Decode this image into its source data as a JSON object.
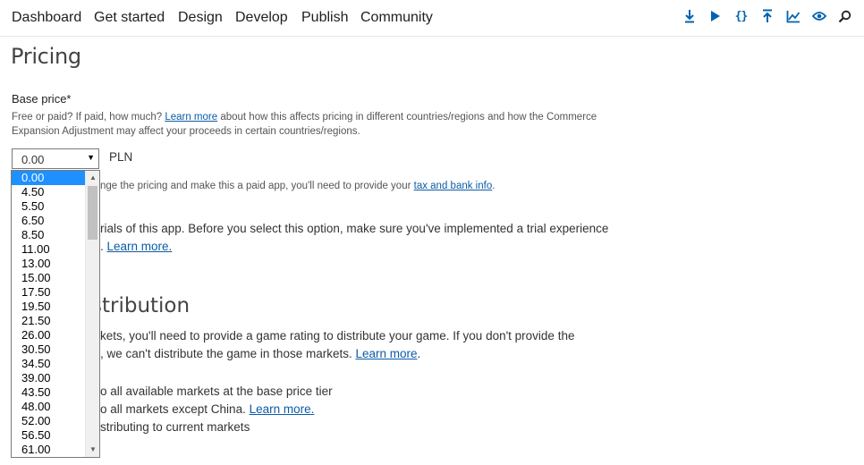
{
  "nav": {
    "items": [
      "Dashboard",
      "Get started",
      "Design",
      "Develop",
      "Publish",
      "Community"
    ]
  },
  "toolbar": {
    "icons": [
      "download-icon",
      "play-icon",
      "code-icon",
      "upload-icon",
      "chart-icon",
      "eye-icon",
      "search-icon"
    ],
    "code_glyph": "{}",
    "accent_color": "#0063b1"
  },
  "page": {
    "title": "Pricing"
  },
  "base_price": {
    "label": "Base price*",
    "desc_before": "Free or paid? If paid, how much?",
    "desc_link": "Learn more",
    "desc_after": " about how this affects pricing in different countries/regions and how the Commerce",
    "desc_line2": "Expansion Adjustment may affect your proceeds in certain countries/regions.",
    "selected_value": "0.00",
    "currency": "PLN"
  },
  "partial": {
    "tax_before": "nge the pricing and make this a paid app, you'll need to provide your ",
    "tax_link": "tax and bank info",
    "tax_after": ".",
    "trial_line1": "rials of this app. Before you select this option, make sure you've implemented a trial experience",
    "trial_line2_before": ". ",
    "trial_link": "Learn more.",
    "heading": "stribution",
    "markets_line1": "kets, you'll need to provide a game rating to distribute your game. If you don't provide the",
    "markets_line2_before": ", we can't distribute the game in those markets. ",
    "markets_link": "Learn more",
    "markets_line2_after": ".",
    "option1": "o all available markets at the base price tier",
    "option2_before": "o all markets except China. ",
    "option2_link": "Learn more.",
    "option3": "stributing to current markets"
  },
  "dropdown": {
    "options": [
      "0.00",
      "4.50",
      "5.50",
      "6.50",
      "8.50",
      "11.00",
      "13.00",
      "15.00",
      "17.50",
      "19.50",
      "21.50",
      "26.00",
      "30.50",
      "34.50",
      "39.00",
      "43.50",
      "48.00",
      "52.00",
      "56.50",
      "61.00"
    ],
    "selected_index": 0,
    "highlight_color": "#1e90ff"
  }
}
